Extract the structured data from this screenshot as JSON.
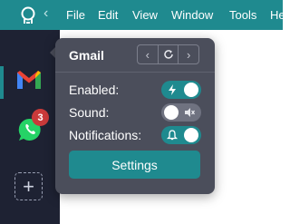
{
  "menubar": {
    "items": [
      "File",
      "Edit",
      "View",
      "Window",
      "Tools",
      "He"
    ]
  },
  "sidebar": {
    "services": [
      {
        "icon": "gmail-icon"
      },
      {
        "icon": "whatsapp-icon",
        "badge": "3"
      }
    ],
    "add_label": "+"
  },
  "popover": {
    "title": "Gmail",
    "rows": [
      {
        "label": "Enabled:",
        "state": "on",
        "icon": "lightning-icon"
      },
      {
        "label": "Sound:",
        "state": "off",
        "icon": "mute-icon"
      },
      {
        "label": "Notifications:",
        "state": "on",
        "icon": "bell-icon"
      }
    ],
    "settings_label": "Settings"
  },
  "colors": {
    "accent": "#1f8a8f",
    "sidebar": "#1e2233",
    "popover": "#4b4e5b",
    "badge": "#c93a3a"
  }
}
